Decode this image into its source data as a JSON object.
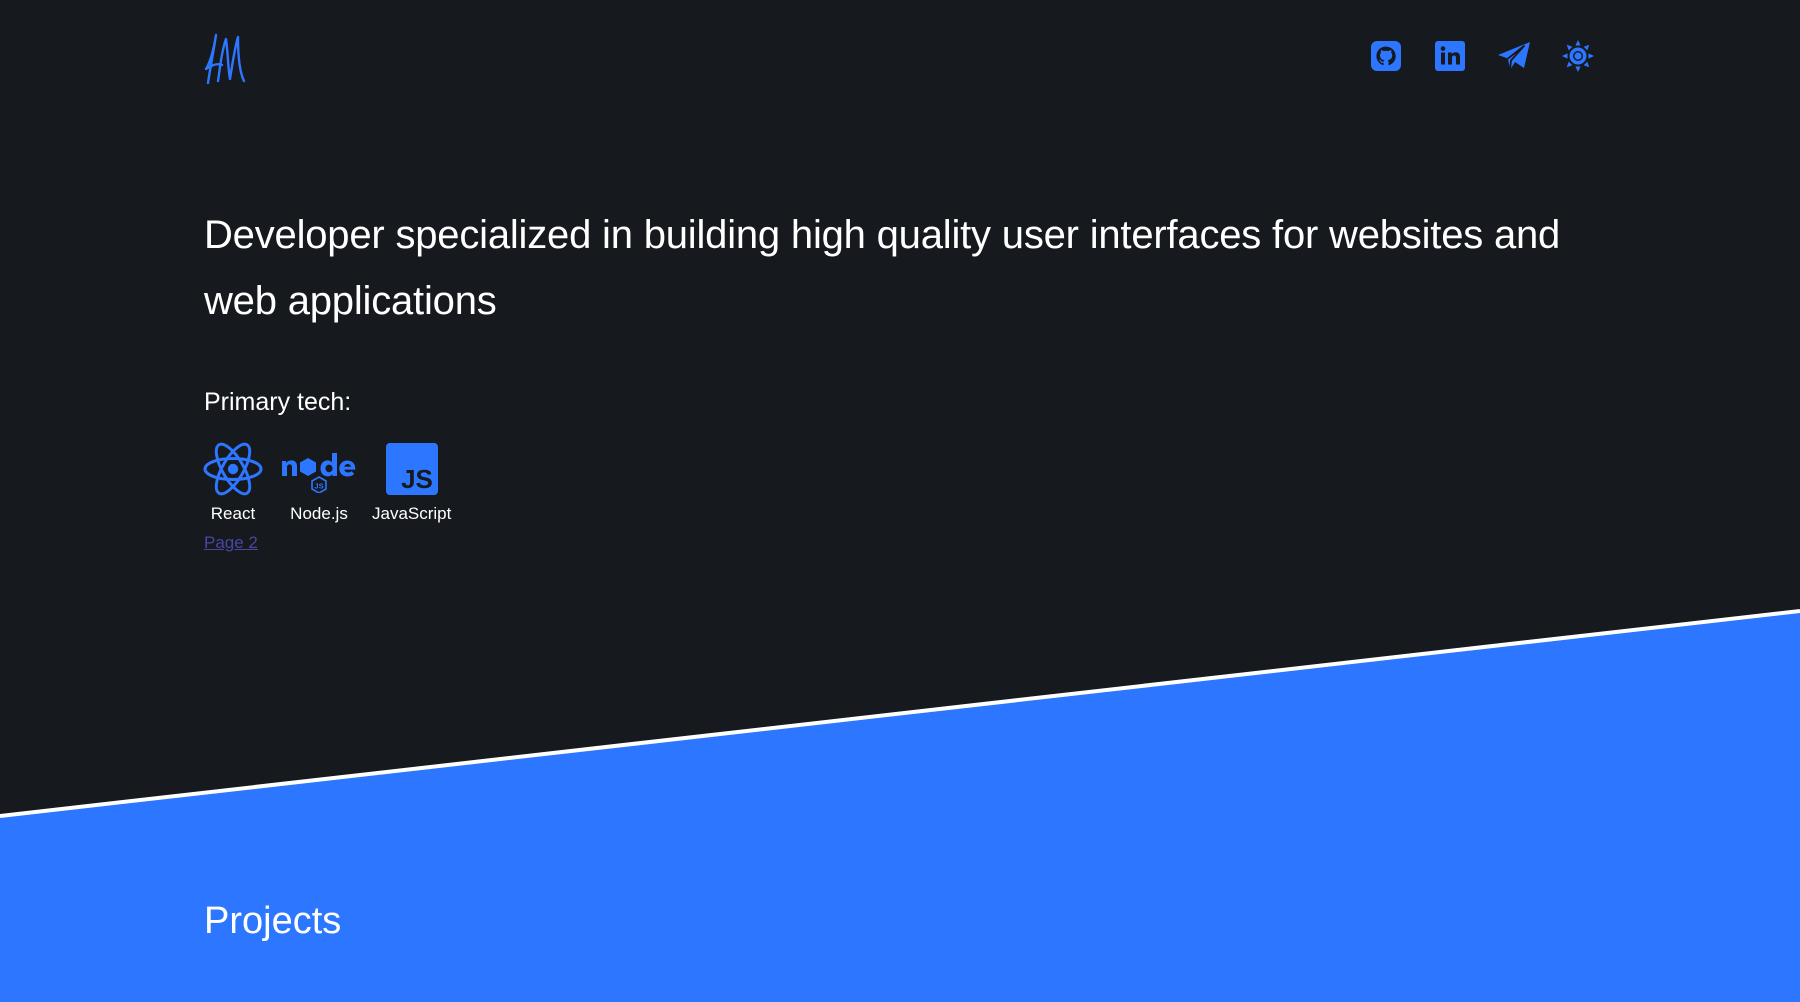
{
  "colors": {
    "background": "#16191d",
    "accent": "#2d76ff",
    "text": "#ffffff",
    "link": "#4a47a3",
    "divider": "#ffffff"
  },
  "header": {
    "logo_icon": "signature-logo-icon",
    "nav_icons": [
      "github-icon",
      "linkedin-icon",
      "telegram-icon",
      "theme-toggle-sun-icon"
    ]
  },
  "hero": {
    "headline": "Developer specialized in building high quality user interfaces for websites and web applications",
    "primary_label": "Primary tech:",
    "tech": [
      {
        "label": "React",
        "icon": "react-icon"
      },
      {
        "label": "Node.js",
        "icon": "nodejs-icon"
      },
      {
        "label": "JavaScript",
        "icon": "javascript-icon"
      }
    ],
    "page_link": "Page 2"
  },
  "projects": {
    "title": "Projects"
  }
}
